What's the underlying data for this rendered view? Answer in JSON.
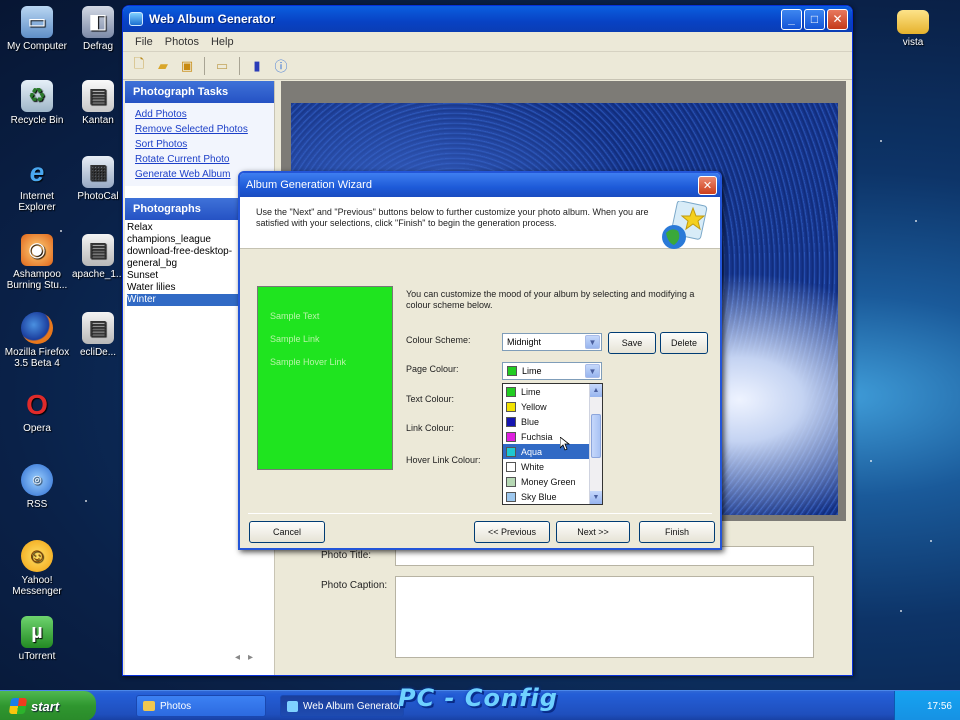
{
  "desktop": {
    "icons": [
      {
        "label": "My Computer",
        "icon": "computer-icon"
      },
      {
        "label": "Defrag",
        "icon": "defrag-icon"
      },
      {
        "label": "Recycle Bin",
        "icon": "recycle-bin-icon"
      },
      {
        "label": "Kantan",
        "icon": "app-icon"
      },
      {
        "label": "Internet Explorer",
        "icon": "ie-icon"
      },
      {
        "label": "PhotoCal",
        "icon": "app-icon"
      },
      {
        "label": "Ashampoo Burning Stu...",
        "icon": "burn-icon"
      },
      {
        "label": "apache_1...",
        "icon": "app-icon"
      },
      {
        "label": "Mozilla Firefox 3.5 Beta 4",
        "icon": "firefox-icon"
      },
      {
        "label": "ecliDe...",
        "icon": "app-icon"
      },
      {
        "label": "Opera",
        "icon": "opera-icon"
      },
      {
        "label": "RSS",
        "icon": "rss-icon"
      },
      {
        "label": "Yahoo! Messenger",
        "icon": "messenger-icon"
      },
      {
        "label": "uTorrent",
        "icon": "utorrent-icon"
      },
      {
        "label": "vista",
        "icon": "folder-icon"
      }
    ]
  },
  "main_window": {
    "title": "Web Album Generator",
    "menu": [
      "File",
      "Photos",
      "Help"
    ],
    "tasks_header": "Photograph Tasks",
    "tasks": [
      "Add Photos",
      "Remove Selected Photos",
      "Sort Photos",
      "Rotate Current Photo",
      "Generate Web Album"
    ],
    "photos_header": "Photographs",
    "photos": [
      "Relax",
      "champions_league",
      "download-free-desktop-",
      "general_bg",
      "Sunset",
      "Water lilies",
      "Winter"
    ],
    "selected_photo": "Winter",
    "photo_title_label": "Photo Title:",
    "photo_caption_label": "Photo Caption:"
  },
  "wizard": {
    "title": "Album Generation Wizard",
    "intro": "Use the \"Next\" and \"Previous\" buttons below to further customize your photo album. When you are satisfied with your selections, click \"Finish\" to begin the generation process.",
    "customize_text": "You can customize the mood of your album by selecting and modifying a colour scheme below.",
    "preview": {
      "sample_text": "Sample Text",
      "sample_link": "Sample Link",
      "sample_hover_link": "Sample Hover Link",
      "page_colour": "#1fe41f"
    },
    "labels": {
      "colour_scheme": "Colour Scheme:",
      "page_colour": "Page Colour:",
      "text_colour": "Text Colour:",
      "link_colour": "Link Colour:",
      "hover_link_colour": "Hover Link Colour:"
    },
    "colour_scheme_value": "Midnight",
    "page_colour_value": "Lime",
    "save_label": "Save",
    "delete_label": "Delete",
    "dropdown_options": [
      {
        "name": "Lime",
        "color": "#22cc22"
      },
      {
        "name": "Yellow",
        "color": "#f2e200"
      },
      {
        "name": "Blue",
        "color": "#1515b0"
      },
      {
        "name": "Fuchsia",
        "color": "#e020e0"
      },
      {
        "name": "Aqua",
        "color": "#1fc8d0"
      },
      {
        "name": "White",
        "color": "#ffffff"
      },
      {
        "name": "Money Green",
        "color": "#b6d8b4"
      },
      {
        "name": "Sky Blue",
        "color": "#9ec8ee"
      }
    ],
    "highlighted_option": "Aqua",
    "cancel_label": "Cancel",
    "previous_label": "<< Previous",
    "next_label": "Next >>",
    "finish_label": "Finish"
  },
  "taskbar": {
    "start_label": "start",
    "items": [
      "Photos",
      "Web Album Generator"
    ],
    "clock": "17:56"
  },
  "watermark": "PC - Config"
}
